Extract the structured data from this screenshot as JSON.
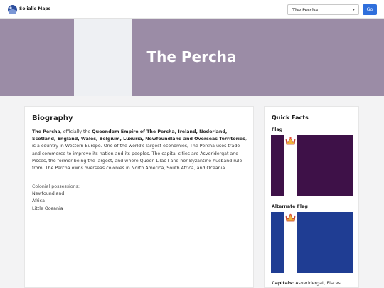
{
  "brand": {
    "name": "Solialis Maps",
    "logo_icon": "globe-logo-icon"
  },
  "search": {
    "selected": "The Percha",
    "go_label": "Go"
  },
  "hero": {
    "title": "The Percha"
  },
  "biography": {
    "heading": "Biography",
    "name_bold": "The Percha",
    "text_1": ", officially the ",
    "official_name": "Queendom Empire of The Percha, Ireland, Nederland, Scotland, England, Wales, Belgium, Luxuria, Newfoundland and Overseas Territories",
    "text_2": ", is a country in Western Europe. One of the world's largest economies, The Percha uses trade and commerce to improve its nation and its peoples. The capital cities are Asveridergat and Pisces, the former being the largest, and where Queen Lilac I and her Byzantine husband rule from. The Percha owns overseas colonies in North America, South Africa, and Oceania.",
    "colonial_label": "Colonial possessions:",
    "colonies": [
      "Newfoundland",
      "Africa",
      "Little Oceania"
    ]
  },
  "quick_facts": {
    "heading": "Quick Facts",
    "flag_label": "Flag",
    "alt_flag_label": "Alternate Flag",
    "capitals_label": "Capitals:",
    "capitals_value": " Asveridergat, Pisces",
    "colors": {
      "flag": "#3e1148",
      "alt_flag": "#1f3d93",
      "hero": "#9b8ca6",
      "button": "#2f6fdc"
    }
  }
}
